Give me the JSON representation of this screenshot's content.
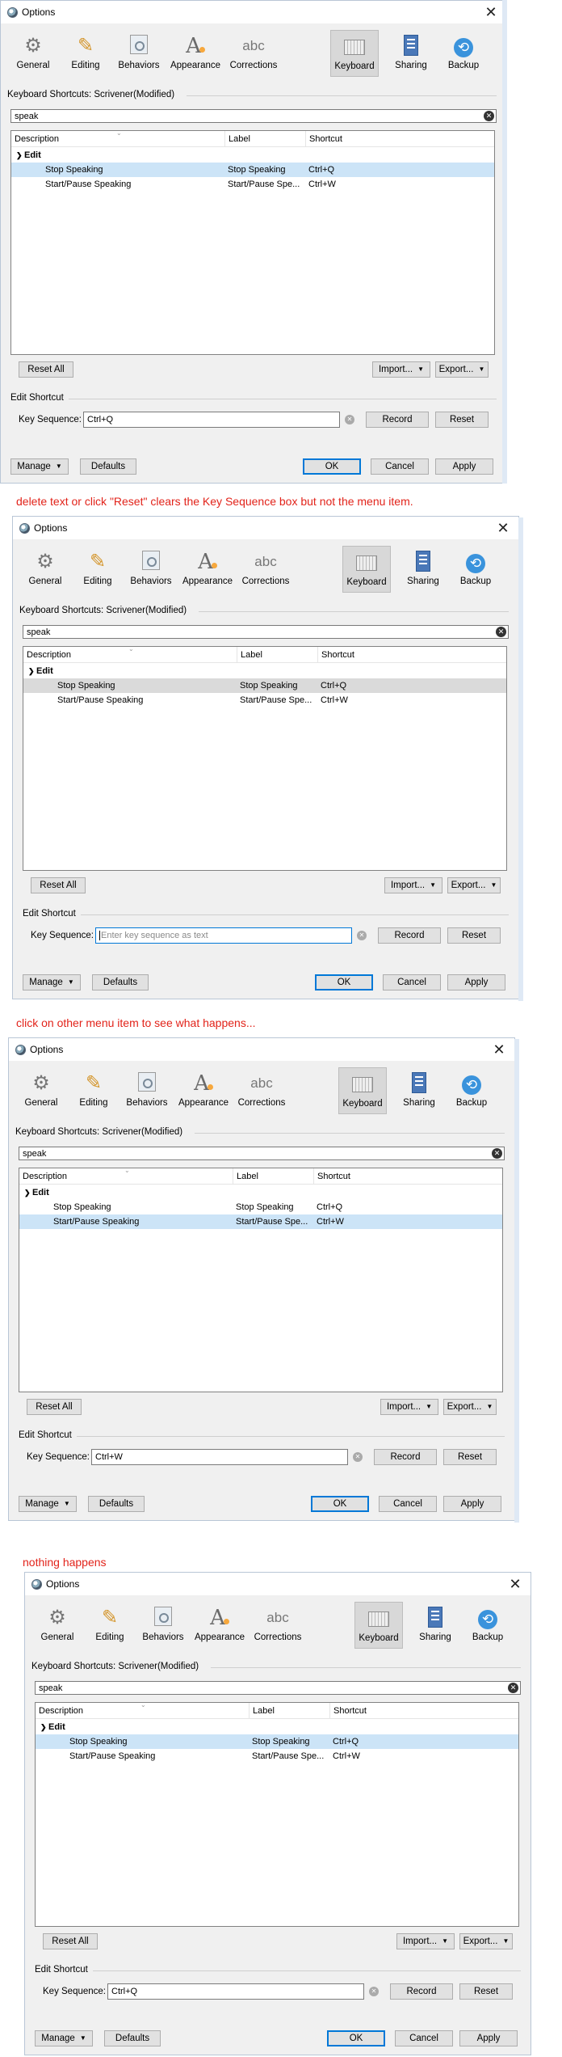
{
  "dialog": {
    "title": "Options",
    "close_glyph": "✕",
    "toolbar": [
      {
        "label": "General",
        "icon": "gear-icon"
      },
      {
        "label": "Editing",
        "icon": "pencil-icon"
      },
      {
        "label": "Behaviors",
        "icon": "behaviors-icon"
      },
      {
        "label": "Appearance",
        "icon": "appearance-icon"
      },
      {
        "label": "Corrections",
        "icon": "corrections-icon",
        "text": "abc"
      },
      {
        "label": "Keyboard",
        "icon": "keyboard-icon"
      },
      {
        "label": "Sharing",
        "icon": "sharing-icon"
      },
      {
        "label": "Backup",
        "icon": "backup-icon"
      }
    ],
    "shortcuts_label": "Keyboard Shortcuts: Scrivener(Modified)",
    "search_value": "speak",
    "columns": [
      "Description",
      "Label",
      "Shortcut"
    ],
    "group": "Edit",
    "rows": [
      {
        "description": "Stop Speaking",
        "label": "Stop Speaking",
        "shortcut": "Ctrl+Q"
      },
      {
        "description": "Start/Pause Speaking",
        "label": "Start/Pause Spe...",
        "shortcut": "Ctrl+W"
      }
    ],
    "reset_all": "Reset All",
    "import": "Import...",
    "export": "Export...",
    "edit_shortcut": "Edit Shortcut",
    "key_sequence_label": "Key Sequence:",
    "record": "Record",
    "reset": "Reset",
    "manage": "Manage",
    "defaults": "Defaults",
    "ok": "OK",
    "cancel": "Cancel",
    "apply": "Apply"
  },
  "panels": [
    {
      "key_sequence": "Ctrl+Q",
      "selected_row": 1
    },
    {
      "key_sequence": "",
      "placeholder": "Enter key sequence as text",
      "selected_row": 1
    },
    {
      "key_sequence": "Ctrl+W",
      "selected_row": 2
    },
    {
      "key_sequence": "Ctrl+Q",
      "selected_row": 1
    }
  ],
  "notes": [
    "delete text or click \"Reset\" clears the Key Sequence box but not the menu item.",
    "click on other menu item to see what happens...",
    "nothing happens"
  ],
  "colors": {
    "note": "#e2231a",
    "selection": "#cce4f7",
    "focus": "#0078d7"
  }
}
